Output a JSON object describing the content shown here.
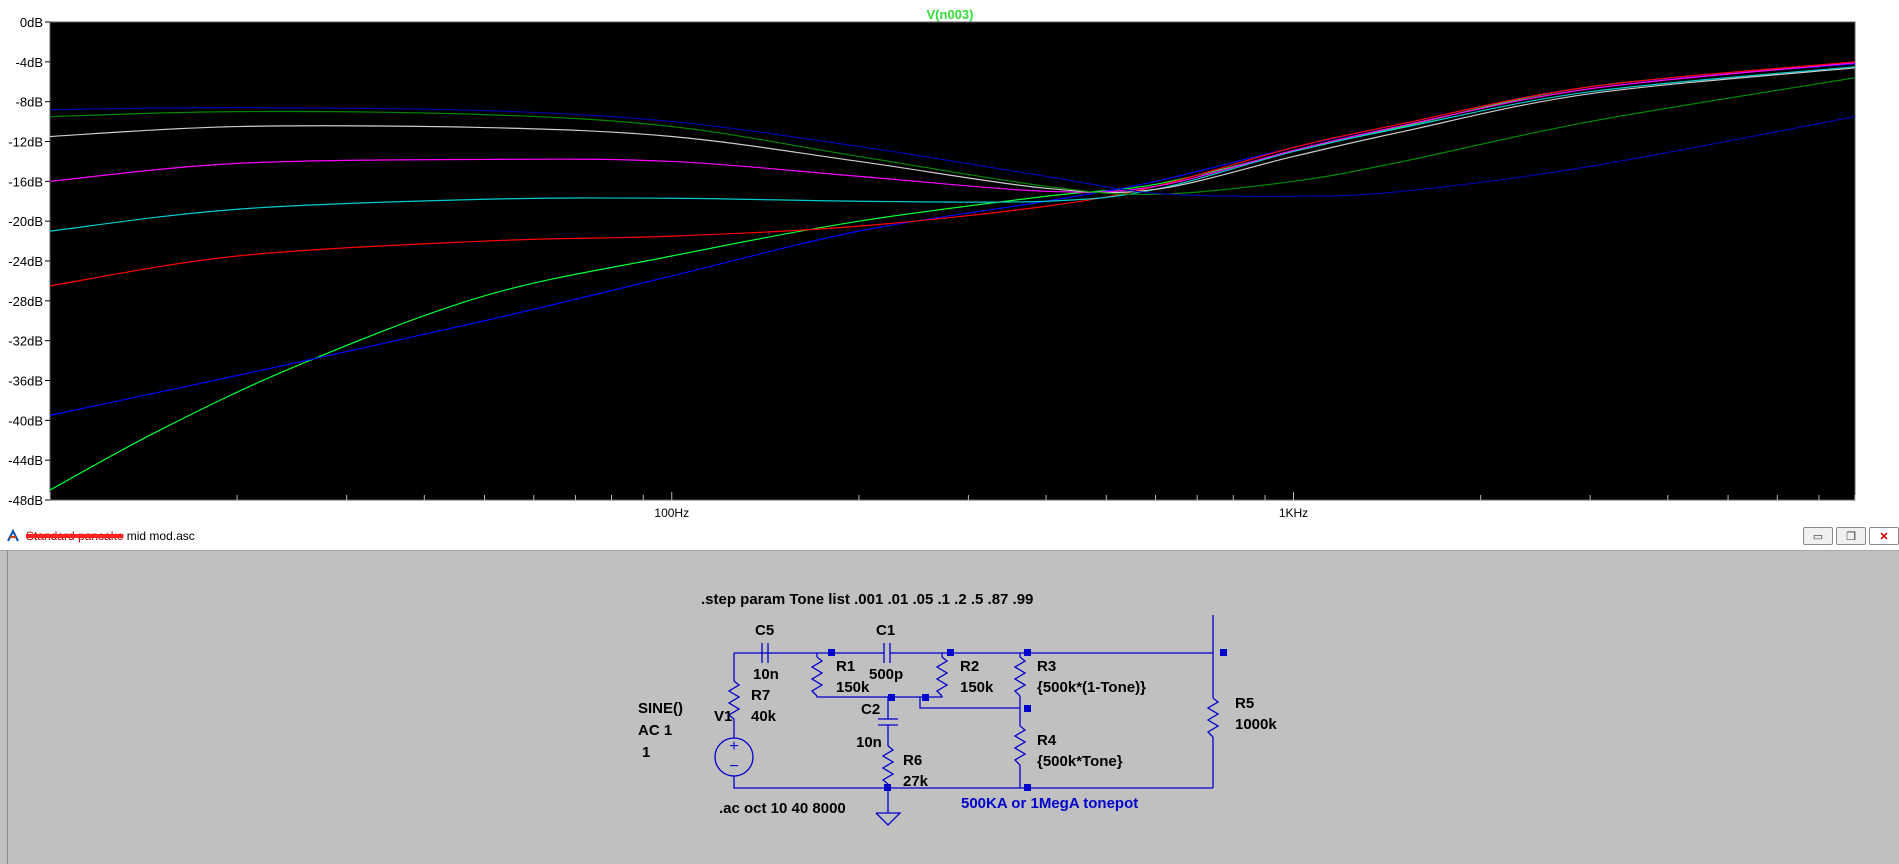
{
  "plot": {
    "trace_name": "V(n003)",
    "y_ticks": [
      "0dB",
      "-4dB",
      "-8dB",
      "-12dB",
      "-16dB",
      "-20dB",
      "-24dB",
      "-28dB",
      "-32dB",
      "-36dB",
      "-40dB",
      "-44dB",
      "-48dB"
    ],
    "x_ticks": [
      "100Hz",
      "1KHz"
    ],
    "colors": {
      "background": "#000000",
      "frame": "#606060",
      "label": "#33dd33"
    },
    "series": [
      {
        "color": "#00ff33",
        "points": [
          [
            10,
            -47
          ],
          [
            15,
            -41
          ],
          [
            25,
            -34.5
          ],
          [
            50,
            -27.5
          ],
          [
            100,
            -23.5
          ],
          [
            200,
            -20
          ],
          [
            400,
            -17.5
          ],
          [
            600,
            -16.3
          ],
          [
            1000,
            -13
          ],
          [
            1500,
            -10.5
          ],
          [
            3000,
            -6.5
          ],
          [
            8000,
            -4.2
          ]
        ]
      },
      {
        "color": "#0000ff",
        "points": [
          [
            10,
            -39.5
          ],
          [
            20,
            -35.5
          ],
          [
            50,
            -30
          ],
          [
            100,
            -25.5
          ],
          [
            200,
            -21
          ],
          [
            400,
            -18
          ],
          [
            600,
            -16
          ],
          [
            1000,
            -12.6
          ],
          [
            1500,
            -10.2
          ],
          [
            3000,
            -6.5
          ],
          [
            8000,
            -4.2
          ]
        ]
      },
      {
        "color": "#ff0000",
        "points": [
          [
            10,
            -26.5
          ],
          [
            20,
            -23.5
          ],
          [
            50,
            -22
          ],
          [
            100,
            -21.5
          ],
          [
            200,
            -20.5
          ],
          [
            400,
            -18.5
          ],
          [
            600,
            -16.5
          ],
          [
            1000,
            -12.6
          ],
          [
            1500,
            -10.2
          ],
          [
            3000,
            -6.5
          ],
          [
            8000,
            -4
          ]
        ]
      },
      {
        "color": "#00cccc",
        "points": [
          [
            10,
            -21
          ],
          [
            20,
            -18.8
          ],
          [
            50,
            -17.8
          ],
          [
            100,
            -17.7
          ],
          [
            200,
            -18
          ],
          [
            400,
            -18
          ],
          [
            600,
            -16.8
          ],
          [
            1000,
            -13
          ],
          [
            1500,
            -10.6
          ],
          [
            3000,
            -7
          ],
          [
            8000,
            -4.5
          ]
        ]
      },
      {
        "color": "#ff00ff",
        "points": [
          [
            10,
            -16
          ],
          [
            20,
            -14.2
          ],
          [
            50,
            -13.8
          ],
          [
            100,
            -14
          ],
          [
            200,
            -15.5
          ],
          [
            400,
            -17
          ],
          [
            600,
            -16.5
          ],
          [
            1000,
            -12.9
          ],
          [
            1500,
            -10.4
          ],
          [
            3000,
            -6.7
          ],
          [
            8000,
            -4.1
          ]
        ]
      },
      {
        "color": "#cccccc",
        "points": [
          [
            10,
            -11.5
          ],
          [
            20,
            -10.5
          ],
          [
            50,
            -10.6
          ],
          [
            100,
            -11.5
          ],
          [
            200,
            -14
          ],
          [
            400,
            -16.7
          ],
          [
            600,
            -16.8
          ],
          [
            1000,
            -13.5
          ],
          [
            1500,
            -11
          ],
          [
            3000,
            -7.2
          ],
          [
            8000,
            -4.6
          ]
        ]
      },
      {
        "color": "#008800",
        "points": [
          [
            10,
            -9.5
          ],
          [
            20,
            -9
          ],
          [
            50,
            -9.3
          ],
          [
            100,
            -10.5
          ],
          [
            200,
            -13.5
          ],
          [
            400,
            -16.5
          ],
          [
            600,
            -17.3
          ],
          [
            1000,
            -16
          ],
          [
            1500,
            -14
          ],
          [
            3000,
            -10
          ],
          [
            8000,
            -5.6
          ]
        ]
      },
      {
        "color": "#0000aa",
        "points": [
          [
            10,
            -8.8
          ],
          [
            20,
            -8.6
          ],
          [
            50,
            -8.9
          ],
          [
            100,
            -10
          ],
          [
            200,
            -12.5
          ],
          [
            400,
            -15.5
          ],
          [
            600,
            -17.2
          ],
          [
            1000,
            -17.5
          ],
          [
            1500,
            -17
          ],
          [
            3000,
            -14.5
          ],
          [
            8000,
            -9.5
          ]
        ]
      }
    ]
  },
  "window": {
    "title_struck": "Standard pancake",
    "title_rest": " mid mod.asc",
    "minimize": "▭",
    "maximize": "❐",
    "close": "✕"
  },
  "schematic": {
    "step_directive": ".step param Tone list .001 .01 .05 .1 .2 .5 .87  .99",
    "ac_directive": ".ac oct 10 40 8000",
    "note": "500KA or 1MegA  tonepot",
    "c5": {
      "name": "C5",
      "value": "10n"
    },
    "c1": {
      "name": "C1",
      "value": "500p"
    },
    "r1": {
      "name": "R1",
      "value": "150k"
    },
    "r2": {
      "name": "R2",
      "value": "150k"
    },
    "r3": {
      "name": "R3",
      "value": "{500k*(1-Tone)}"
    },
    "r4": {
      "name": "R4",
      "value": "{500k*Tone}"
    },
    "r5": {
      "name": "R5",
      "value": "1000k"
    },
    "r6": {
      "name": "R6",
      "value": "27k"
    },
    "r7": {
      "name": "R7",
      "value": "40k"
    },
    "c2": {
      "name": "C2",
      "value": "10n"
    },
    "v1": {
      "name": "V1",
      "line1": "SINE()",
      "line2": "AC 1",
      "line3": "1"
    }
  }
}
